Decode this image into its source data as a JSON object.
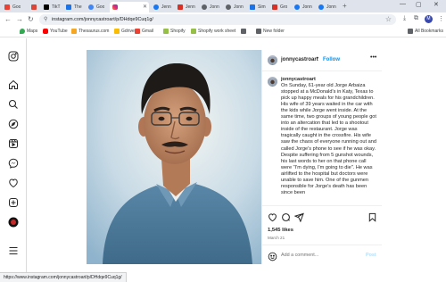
{
  "browser": {
    "tabs": [
      {
        "label": "Goo",
        "color": "#ea4335"
      },
      {
        "label": "",
        "color": "#db4437"
      },
      {
        "label": "TikT",
        "color": "#000000"
      },
      {
        "label": "The",
        "color": "#1a73e8"
      },
      {
        "label": "Goo",
        "color": "#4285f4"
      },
      {
        "label": "",
        "color": "#e1306c"
      },
      {
        "label": "Jenn",
        "color": "#1877f2"
      },
      {
        "label": "Jenn",
        "color": "#d93025"
      },
      {
        "label": "Jonn",
        "color": "#5f6368"
      },
      {
        "label": "Jonn",
        "color": "#5f6368"
      },
      {
        "label": "Sim",
        "color": "#1a73e8"
      },
      {
        "label": "Gro",
        "color": "#d93025"
      },
      {
        "label": "Jonn",
        "color": "#1877f2"
      },
      {
        "label": "Jonn",
        "color": "#1877f2"
      }
    ],
    "active_tab_index": 5,
    "url": "instagram.com/jonnycastroart/p/DHdqe9Cuq1g/",
    "profile_initial": "M",
    "bookmarks": [
      {
        "label": "Maps",
        "color": "#34a853"
      },
      {
        "label": "YouTube",
        "color": "#ff0000"
      },
      {
        "label": "Thesaurus.com",
        "color": "#f5a623"
      },
      {
        "label": "Gdrive",
        "color": "#fbbc04"
      },
      {
        "label": "Gmail",
        "color": "#ea4335"
      },
      {
        "label": "Shopify",
        "color": "#95bf47"
      },
      {
        "label": "Shopify work sheet",
        "color": "#95bf47"
      },
      {
        "label": "",
        "color": "#5f6368"
      },
      {
        "label": "New folder",
        "color": "#5f6368"
      }
    ],
    "all_bookmarks": "All Bookmarks",
    "status_url": "https://www.instagram.com/jonnycastroart/p/DHdqe9Cuq1g/"
  },
  "instagram": {
    "sidebar_icons": [
      "instagram-logo-icon",
      "home-icon",
      "search-icon",
      "explore-icon",
      "reels-icon",
      "messenger-icon",
      "heart-icon",
      "create-icon",
      "profile-icon",
      "menu-icon"
    ],
    "post": {
      "username": "jonnycastroart",
      "dot": "•",
      "follow": "Follow",
      "more": "•••",
      "caption_user": "jonnycastroart",
      "caption": "On Sunday, 61-year old Jorge Arbaiza stopped at a McDonald's in Katy, Texas to pick up happy meals for his grandchildren. His wife of 39 years waited in the car with the kids while Jorge went inside. At the same time, two groups of young people got into an altercation that led to a shootout inside of the restaurant. Jorge was tragically caught in the crossfire. His wife saw the chaos of everyone running out and called Jorge's phone to see if he was okay. Despite suffering from 5 gunshot wounds, his last words to her on that phone call were \"I'm dying, I'm going to die\". He was airlifted to the hospital but doctors were unable to save him. One of the gunmen responsible for Jorge's death has been since been",
      "likes": "1,545 likes",
      "date": "March 21",
      "comment_placeholder": "Add a comment...",
      "post_label": "Post"
    }
  }
}
